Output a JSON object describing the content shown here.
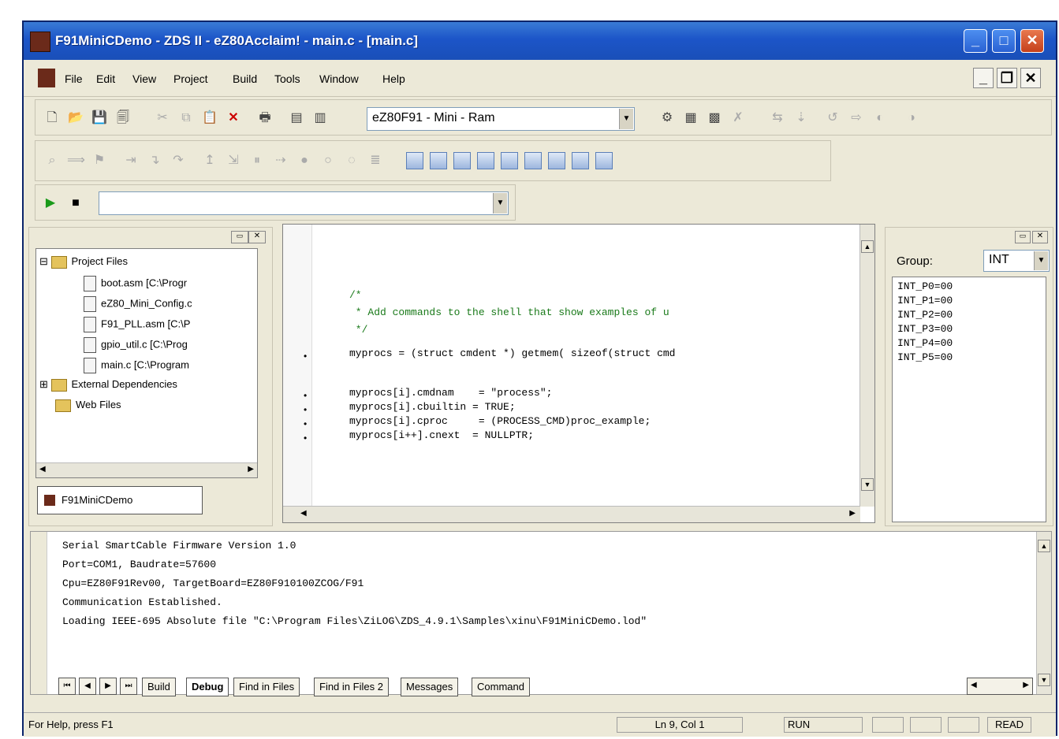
{
  "window": {
    "title": "F91MiniCDemo - ZDS II - eZ80Acclaim! - main.c - [main.c]",
    "minimize_label": "_",
    "maximize_label": "□",
    "close_label": "✕"
  },
  "menubar": {
    "items": [
      "File",
      "Edit",
      "View",
      "Project",
      "Build",
      "Tools",
      "Window",
      "Help"
    ],
    "mdi_minimize": "_",
    "mdi_restore": "❐",
    "mdi_close": "✕"
  },
  "toolbar": {
    "config_value": "eZ80F91 - Mini - Ram",
    "run_value": ""
  },
  "workspace": {
    "tree": {
      "project_files": "Project Files",
      "files": [
        "boot.asm [C:\\Progr",
        "eZ80_Mini_Config.c",
        "F91_PLL.asm [C:\\P",
        "gpio_util.c [C:\\Prog",
        "main.c [C:\\Program"
      ],
      "external_dependencies": "External Dependencies",
      "web_files": "Web Files"
    },
    "tab_label": "F91MiniCDemo"
  },
  "editor": {
    "lines": [
      "/*",
      " * Add commands to the shell that show examples of u",
      " */",
      "myprocs = (struct cmdent *) getmem( sizeof(struct cmd",
      "",
      "myprocs[i].cmdnam    = \"process\";",
      "myprocs[i].cbuiltin = TRUE;",
      "myprocs[i].cproc     = (PROCESS_CMD)proc_example;",
      "myprocs[i++].cnext  = NULLPTR;"
    ]
  },
  "registers": {
    "group_label": "Group:",
    "group_value": "INT",
    "items": [
      "INT_P0=00",
      "INT_P1=00",
      "INT_P2=00",
      "INT_P3=00",
      "INT_P4=00",
      "INT_P5=00"
    ]
  },
  "output": {
    "lines": [
      "Serial SmartCable Firmware Version 1.0",
      "Port=COM1, Baudrate=57600",
      "Cpu=EZ80F91Rev00, TargetBoard=EZ80F910100ZCOG/F91",
      "Communication Established.",
      "Loading IEEE-695 Absolute file \"C:\\Program Files\\ZiLOG\\ZDS_4.9.1\\Samples\\xinu\\F91MiniCDemo.lod\""
    ],
    "tabs": [
      "Build",
      "Debug",
      "Find in Files",
      "Find in Files 2",
      "Messages",
      "Command"
    ],
    "active_tab": "Debug"
  },
  "statusbar": {
    "help_text": "For Help, press F1",
    "position": "Ln 9, Col 1",
    "run_state": "RUN",
    "mode": "READ"
  }
}
